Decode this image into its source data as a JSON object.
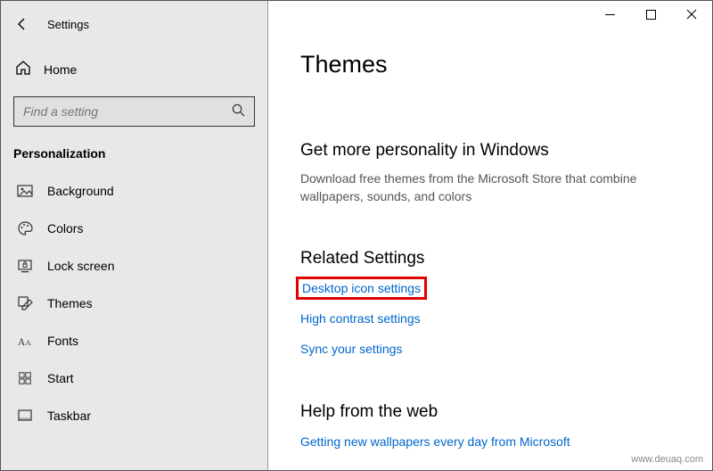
{
  "header": {
    "app_title": "Settings",
    "home_label": "Home",
    "search_placeholder": "Find a setting",
    "category": "Personalization"
  },
  "sidebar": {
    "items": [
      {
        "label": "Background"
      },
      {
        "label": "Colors"
      },
      {
        "label": "Lock screen"
      },
      {
        "label": "Themes"
      },
      {
        "label": "Fonts"
      },
      {
        "label": "Start"
      },
      {
        "label": "Taskbar"
      }
    ]
  },
  "main": {
    "page_title": "Themes",
    "more_title": "Get more personality in Windows",
    "more_desc": "Download free themes from the Microsoft Store that combine wallpapers, sounds, and colors",
    "related_title": "Related Settings",
    "links": {
      "desktop_icons": "Desktop icon settings",
      "high_contrast": "High contrast settings",
      "sync": "Sync your settings"
    },
    "help_title": "Help from the web",
    "help_link": "Getting new wallpapers every day from Microsoft"
  },
  "watermark": "www.deuaq.com"
}
